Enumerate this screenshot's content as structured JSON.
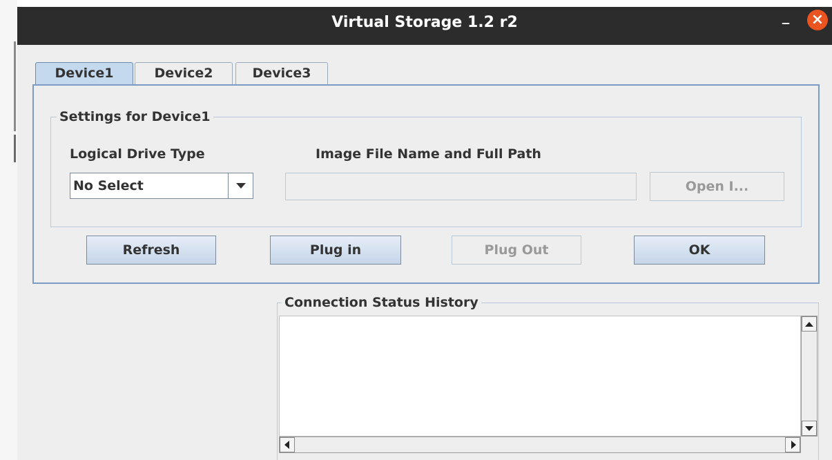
{
  "window": {
    "title": "Virtual Storage 1.2 r2",
    "minimize_glyph": "–",
    "close_glyph": "×"
  },
  "tabs": [
    {
      "label": "Device1",
      "active": true
    },
    {
      "label": "Device2",
      "active": false
    },
    {
      "label": "Device3",
      "active": false
    }
  ],
  "settings": {
    "group_title": "Settings for Device1",
    "drive_type_label": "Logical Drive Type",
    "drive_type_value": "No Select",
    "image_path_label": "Image File Name and Full Path",
    "image_path_value": "",
    "open_button_label": "Open I..."
  },
  "actions": {
    "refresh_label": "Refresh",
    "plug_in_label": "Plug in",
    "plug_out_label": "Plug Out",
    "ok_label": "OK"
  },
  "history": {
    "title": "Connection Status History"
  },
  "colors": {
    "titlebar": "#2c2c2c",
    "close_button": "#e95420",
    "active_tab": "#c5d9ee",
    "panel_border": "#7b9ac4",
    "window_background": "#eeeeee"
  }
}
